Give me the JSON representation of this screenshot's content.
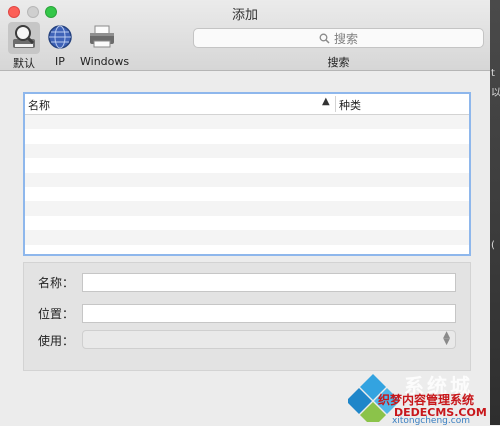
{
  "window": {
    "title": "添加"
  },
  "toolbar": {
    "items": [
      {
        "label": "默认",
        "icon": "magnifier-printer-icon",
        "selected": true
      },
      {
        "label": "IP",
        "icon": "globe-icon",
        "selected": false
      },
      {
        "label": "Windows",
        "icon": "printer-icon",
        "selected": false
      }
    ],
    "search": {
      "placeholder": "搜索",
      "caption": "搜索"
    }
  },
  "list": {
    "columns": [
      {
        "label": "名称",
        "sorted": "ascending"
      },
      {
        "label": "种类"
      }
    ],
    "rows": []
  },
  "form": {
    "name_label": "名称：",
    "location_label": "位置：",
    "use_label": "使用：",
    "name_value": "",
    "location_value": "",
    "use_value": ""
  },
  "watermark": {
    "brand": "系统城",
    "line1": "织梦内容管理系统",
    "line2": "DEDECMS.COM",
    "small": "xitongcheng.com"
  },
  "colors": {
    "close": "#fc5f57",
    "zoom": "#34c749",
    "list_focus_border": "#8eb7ec",
    "watermark_text": "#c8171b"
  }
}
